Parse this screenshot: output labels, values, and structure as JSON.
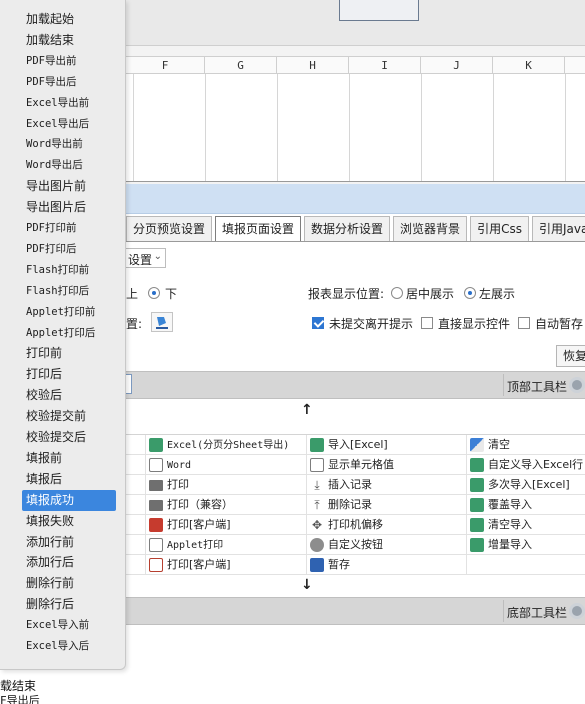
{
  "column_headers": [
    "F",
    "G",
    "H",
    "I",
    "J",
    "K"
  ],
  "tabs": [
    {
      "label": "分页预览设置",
      "active": false
    },
    {
      "label": "填报页面设置",
      "active": true
    },
    {
      "label": "数据分析设置",
      "active": false
    },
    {
      "label": "浏览器背景",
      "active": false
    },
    {
      "label": "引用Css",
      "active": false
    },
    {
      "label": "引用JavaSc",
      "active": false
    }
  ],
  "settings": {
    "dropdown_fragment": "设置",
    "position_fragment_up": "上",
    "position_down_label": "下",
    "report_position_label": "报表显示位置:",
    "center_display": "居中展示",
    "left_display": "左展示",
    "position_fragment_brush": "置:",
    "unsubmitted_leave_prompt": "未提交离开提示",
    "direct_show_controls": "直接显示控件",
    "auto_save": "自动暂存",
    "restore_button": "恢复"
  },
  "toolbars": {
    "top_label": "顶部工具栏",
    "bottom_label": "底部工具栏"
  },
  "toolbar_items": [
    [
      "Excel(分页分Sheet导出)",
      "导入[Excel]",
      "清空"
    ],
    [
      "Word",
      "显示单元格值",
      "自定义导入Excel行"
    ],
    [
      "打印",
      "插入记录",
      "多次导入[Excel]"
    ],
    [
      "打印（兼容）",
      "删除记录",
      "覆盖导入"
    ],
    [
      "打印[客户端]",
      "打印机偏移",
      "清空导入"
    ],
    [
      "Applet打印",
      "自定义按钮",
      "增量导入"
    ],
    [
      "打印[客户端]",
      "暂存",
      ""
    ]
  ],
  "toolbar_icons": [
    [
      "excel-icon",
      "import-excel-icon",
      "clear-icon"
    ],
    [
      "word-icon",
      "cell-value-icon",
      "custom-import-icon"
    ],
    [
      "print-icon",
      "insert-record-icon",
      "multi-import-icon"
    ],
    [
      "print-compat-icon",
      "delete-record-icon",
      "overwrite-import-icon"
    ],
    [
      "print-client-icon",
      "printer-offset-icon",
      "clear-import-icon"
    ],
    [
      "applet-print-icon",
      "custom-button-icon",
      "incremental-import-icon"
    ],
    [
      "pdf-print-icon",
      "save-draft-icon",
      ""
    ]
  ],
  "event_list": [
    "加载起始",
    "加载结束",
    "PDF导出前",
    "PDF导出后",
    "Excel导出前",
    "Excel导出后",
    "Word导出前",
    "Word导出后",
    "导出图片前",
    "导出图片后",
    "PDF打印前",
    "PDF打印后",
    "Flash打印前",
    "Flash打印后",
    "Applet打印前",
    "Applet打印后",
    "打印前",
    "打印后",
    "校验后",
    "校验提交前",
    "校验提交后",
    "填报前",
    "填报后",
    "填报成功",
    "填报失败",
    "添加行前",
    "添加行后",
    "删除行前",
    "删除行后",
    "Excel导入前",
    "Excel导入后"
  ],
  "selected_event": "填报成功",
  "under_text": [
    "载结束",
    "F导出后"
  ],
  "colors": {
    "selection": "#3b86de",
    "tab_strip_blue": "#cfe0f3",
    "toolbar_bar": "#d6d6d6"
  }
}
